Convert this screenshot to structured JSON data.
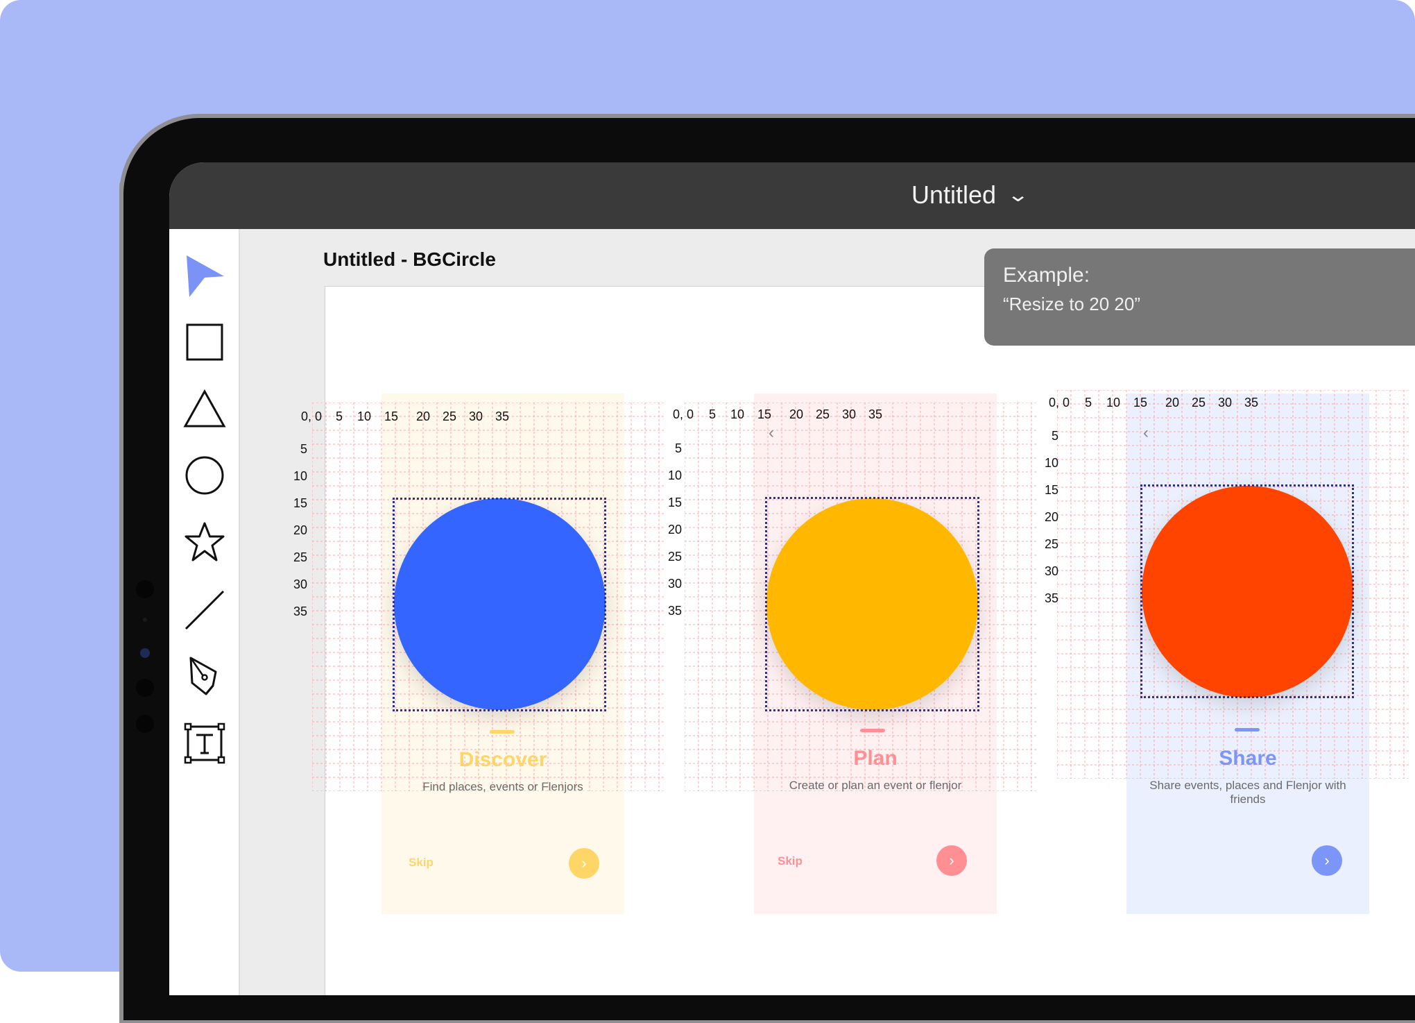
{
  "window": {
    "document_title": "Untitled",
    "title_chevron_icon": "chevron-down-icon"
  },
  "toolbar": {
    "tools": [
      "select-arrow-icon",
      "rectangle-icon",
      "triangle-icon",
      "circle-icon",
      "star-icon",
      "line-icon",
      "pen-icon",
      "text-icon"
    ]
  },
  "canvas": {
    "title": "Untitled - BGCircle"
  },
  "tooltip": {
    "title": "Example:",
    "text": "“Resize to 20 20”"
  },
  "grid_labels": {
    "origin": "0, 0",
    "x_ticks": [
      "5",
      "10",
      "15",
      "20",
      "25",
      "30",
      "35"
    ],
    "y_ticks": [
      "5",
      "10",
      "15",
      "20",
      "25",
      "30",
      "35"
    ]
  },
  "cards": [
    {
      "title": "Discover",
      "subtitle": "Find places, events or Flenjors",
      "skip": "Skip",
      "bg_color": "#fff9ec",
      "accent_color": "#fdd667",
      "circle_color": "#3565ff",
      "next_icon": "chevron-right-icon"
    },
    {
      "title": "Plan",
      "subtitle": "Create or plan an event or flenjor",
      "skip": "Skip",
      "bg_color": "#fff1f1",
      "accent_color": "#ff8f93",
      "circle_color": "#ffb700",
      "next_icon": "chevron-right-icon",
      "back_icon": "chevron-left-icon"
    },
    {
      "title": "Share",
      "subtitle": "Share events, places and Flenjor with friends",
      "bg_color": "#ebf0fe",
      "accent_color": "#7b96f6",
      "circle_color": "#ff4400",
      "next_icon": "chevron-right-icon",
      "back_icon": "chevron-left-icon"
    }
  ]
}
